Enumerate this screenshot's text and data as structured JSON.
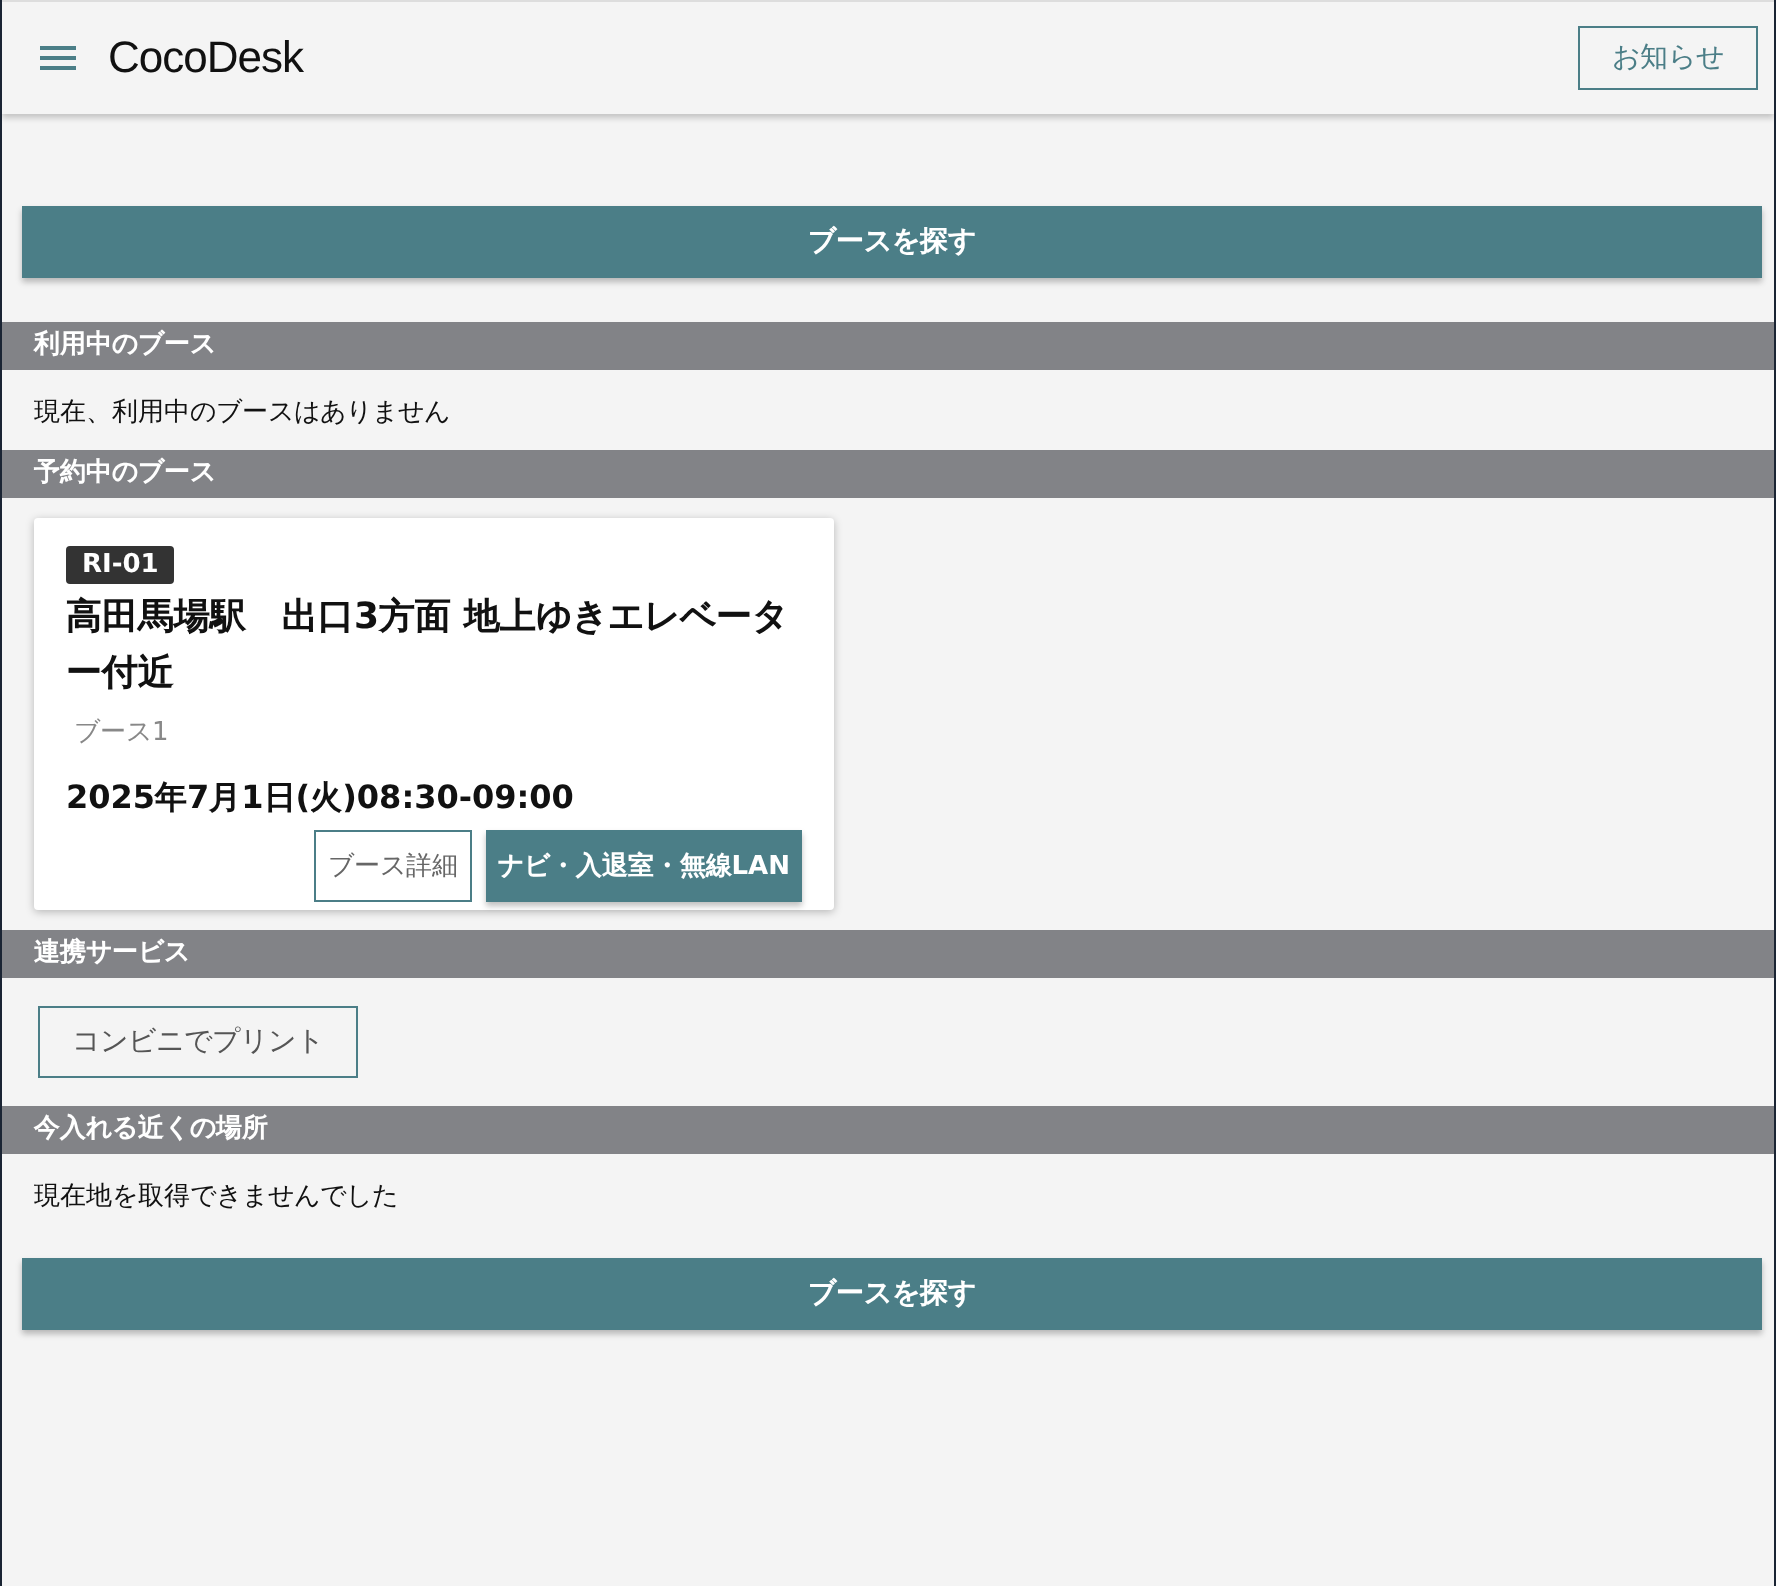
{
  "header": {
    "app_name": "CocoDesk",
    "notice_button": "お知らせ"
  },
  "search_button": "ブースを探す",
  "sections": [
    {
      "kind": "message",
      "title": "利用中のブース",
      "message": "現在、利用中のブースはありません"
    },
    {
      "kind": "reservations",
      "title": "予約中のブース",
      "cards": [
        {
          "code": "RI-01",
          "name": "高田馬場駅　出口3方面 地上ゆきエレベーター付近",
          "booth": "ブース1",
          "time": "2025年7月1日(火)08:30-09:00",
          "detail_button": "ブース詳細",
          "nav_button": "ナビ・入退室・無線LAN"
        }
      ]
    },
    {
      "kind": "services",
      "title": "連携サービス",
      "buttons": [
        "コンビニでプリント"
      ]
    },
    {
      "kind": "message",
      "title": "今入れる近くの場所",
      "message": "現在地を取得できませんでした"
    }
  ],
  "bottom_button": "ブースを探す"
}
